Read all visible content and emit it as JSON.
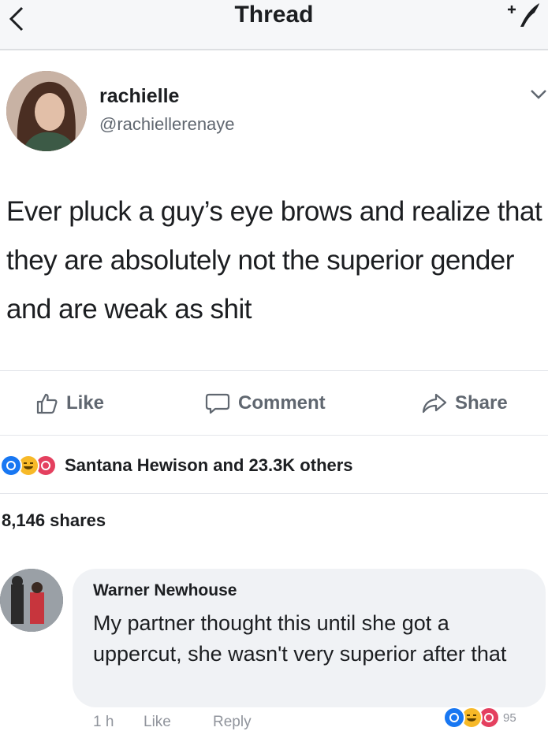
{
  "header": {
    "title": "Thread"
  },
  "post": {
    "author_name": "rachielle",
    "author_handle": "@rachiellerenaye",
    "text": "Ever pluck a guy’s eye brows and realize that they are absolutely not the superior gender and are weak as shit"
  },
  "actions": {
    "like": "Like",
    "comment": "Comment",
    "share": "Share"
  },
  "reactions": {
    "summary": "Santana Hewison and 23.3K others"
  },
  "shares": "8,146 shares",
  "comment": {
    "name": "Warner Newhouse",
    "text": "My partner thought this until she got a uppercut, she wasn't very superior after that",
    "time": "1 h",
    "like": "Like",
    "reply": "Reply",
    "reaction_count": "95"
  },
  "colors": {
    "blue": "#1877f2",
    "red": "#e4405f",
    "yellow": "#f7b928",
    "muted": "#606770"
  },
  "icons": [
    "back-icon",
    "compose-icon",
    "chevron-down-icon",
    "like-icon",
    "comment-icon",
    "share-icon",
    "like-reaction-icon",
    "haha-reaction-icon",
    "love-reaction-icon"
  ]
}
